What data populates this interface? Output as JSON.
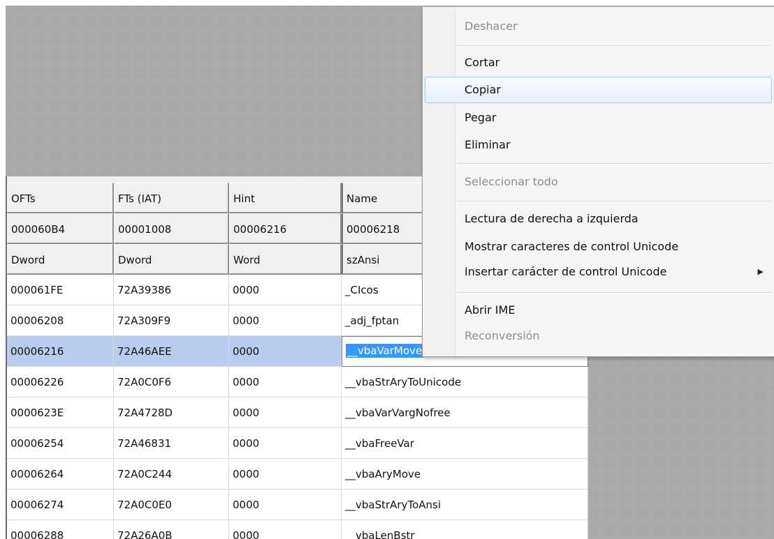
{
  "table": {
    "headers": [
      [
        "OFTs",
        "FTs (IAT)",
        "Hint",
        "Name"
      ],
      [
        "000060B4",
        "00001008",
        "00006216",
        "00006218"
      ],
      [
        "Dword",
        "Dword",
        "Word",
        "szAnsi"
      ]
    ],
    "rows": [
      [
        "000061FE",
        "72A39386",
        "0000",
        "_CIcos"
      ],
      [
        "00006208",
        "72A309F9",
        "0000",
        "_adj_fptan"
      ],
      [
        "00006216",
        "72A46AEE",
        "0000",
        "__vbaVarMove"
      ],
      [
        "00006226",
        "72A0C0F6",
        "0000",
        "__vbaStrAryToUnicode"
      ],
      [
        "0000623E",
        "72A4728D",
        "0000",
        "__vbaVarVargNofree"
      ],
      [
        "00006254",
        "72A46831",
        "0000",
        "__vbaFreeVar"
      ],
      [
        "00006264",
        "72A0C244",
        "0000",
        "__vbaAryMove"
      ],
      [
        "00006274",
        "72A0C0E0",
        "0000",
        "__vbaStrAryToAnsi"
      ],
      [
        "00006288",
        "72A26A0B",
        "0000",
        "__vbaLenBstr"
      ]
    ],
    "selected_row_index": 2
  },
  "context_menu": {
    "items": [
      {
        "label": "Deshacer",
        "enabled": false
      },
      {
        "label": "Cortar",
        "enabled": true
      },
      {
        "label": "Copiar",
        "enabled": true,
        "hover": true
      },
      {
        "label": "Pegar",
        "enabled": true
      },
      {
        "label": "Eliminar",
        "enabled": true
      },
      {
        "label": "Seleccionar todo",
        "enabled": false
      },
      {
        "label": "Lectura de derecha a izquierda",
        "enabled": true
      },
      {
        "label": "Mostrar caracteres de control Unicode",
        "enabled": true
      },
      {
        "label": "Insertar carácter de control Unicode",
        "enabled": true,
        "submenu": true
      },
      {
        "label": "Abrir IME",
        "enabled": true
      },
      {
        "label": "Reconversión",
        "enabled": false
      }
    ],
    "submenu_arrow_icon": "triangle-right-icon"
  }
}
